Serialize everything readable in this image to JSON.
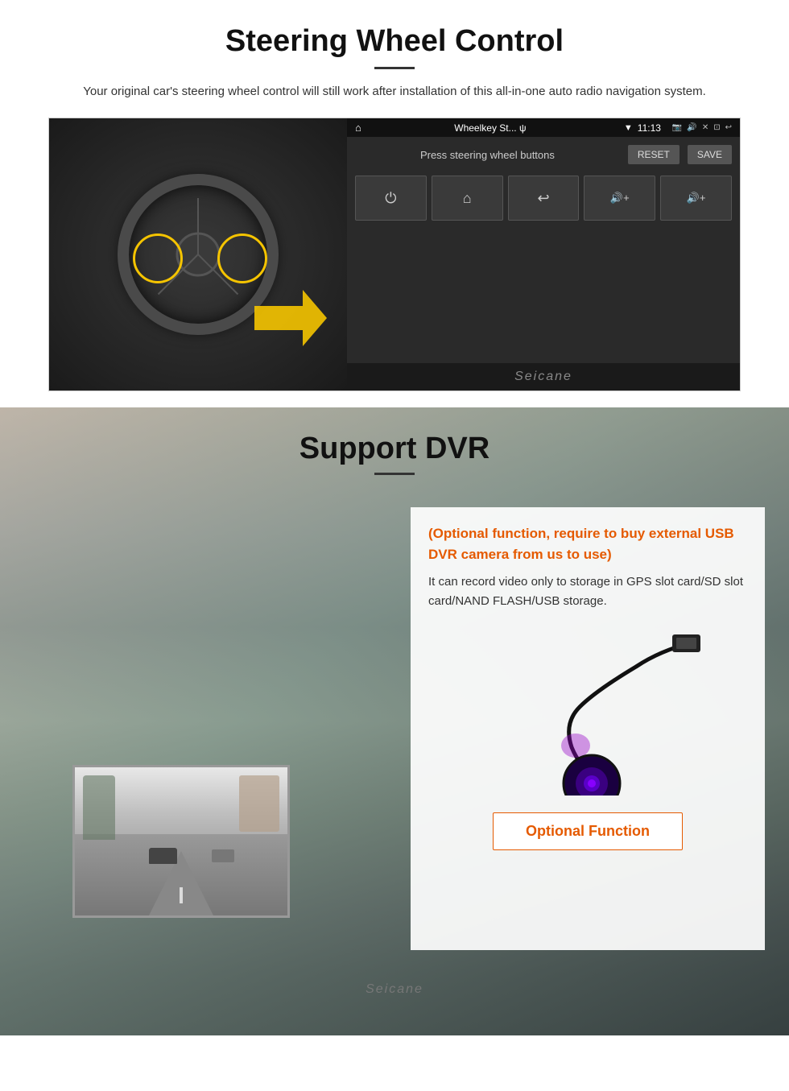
{
  "steering": {
    "title": "Steering Wheel Control",
    "description": "Your original car's steering wheel control will still work after installation of this all-in-one auto radio navigation system.",
    "android": {
      "app_name": "Wheelkey St... ψ",
      "time": "11:13",
      "label": "Press steering wheel buttons",
      "reset_btn": "RESET",
      "save_btn": "SAVE",
      "keys": [
        "⏻",
        "⌂",
        "↩",
        "🔊+",
        "🔊+"
      ]
    },
    "watermark": "Seicane"
  },
  "dvr": {
    "title": "Support DVR",
    "optional_text": "(Optional function, require to buy external USB DVR camera from us to use)",
    "description": "It can record video only to storage in GPS slot card/SD slot card/NAND FLASH/USB storage.",
    "optional_btn": "Optional Function",
    "watermark": "Seicane"
  }
}
